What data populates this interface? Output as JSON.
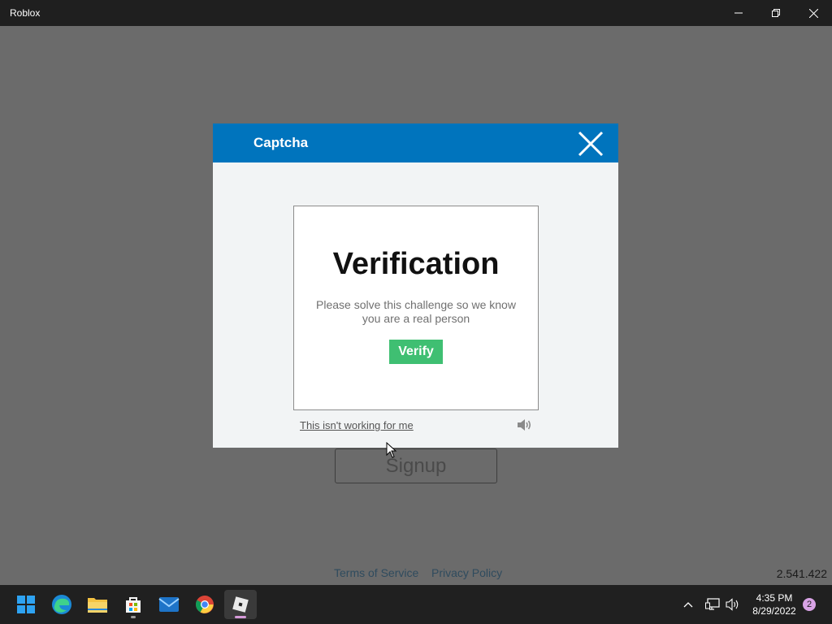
{
  "window": {
    "title": "Roblox",
    "controls": {
      "minimize_icon": "minimize-icon",
      "maximize_icon": "restore-icon",
      "close_icon": "close-icon"
    }
  },
  "app": {
    "signup_label": "Signup",
    "footer": {
      "terms": "Terms of Service",
      "privacy": "Privacy Policy"
    },
    "version": "2.541.422"
  },
  "captcha": {
    "title": "Captcha",
    "heading": "Verification",
    "message": "Please solve this challenge so we know you are a real person",
    "verify_label": "Verify",
    "not_working_link": "This isn't working for me",
    "audio_icon": "speaker-icon",
    "colors": {
      "header": "#0074bd",
      "verify": "#3fbf72"
    }
  },
  "taskbar": {
    "apps": [
      "start-icon",
      "edge-icon",
      "file-explorer-icon",
      "microsoft-store-icon",
      "mail-icon",
      "chrome-icon",
      "roblox-icon"
    ],
    "tray": {
      "time": "4:35 PM",
      "date": "8/29/2022",
      "notifications": "2"
    }
  }
}
